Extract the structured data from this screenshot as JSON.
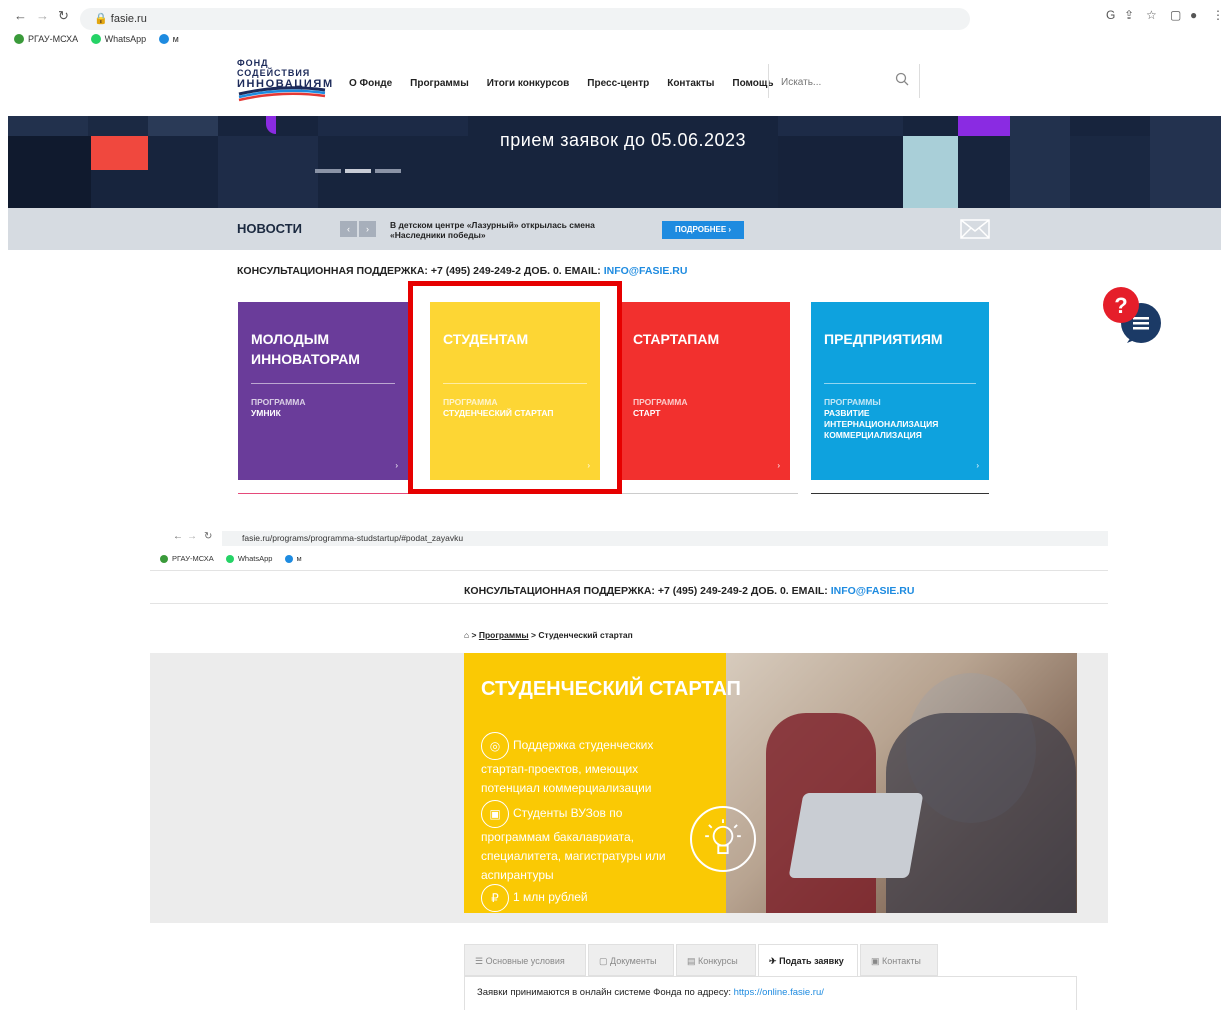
{
  "browser1": {
    "url": "fasie.ru",
    "bookmarks": [
      {
        "label": "РГАУ-МСХА",
        "color": "#3a9a3a"
      },
      {
        "label": "WhatsApp",
        "color": "#25d366"
      },
      {
        "label": "м",
        "color": "#1e8be0"
      }
    ]
  },
  "header": {
    "logo_line1": "ФОНД СОДЕЙСТВИЯ",
    "logo_line2": "ИННОВАЦИЯМ",
    "menu": [
      "О Фонде",
      "Программы",
      "Итоги конкурсов",
      "Пресс-центр",
      "Контакты",
      "Помощь"
    ],
    "search_placeholder": "Искать..."
  },
  "hero": {
    "text": "прием заявок до 05.06.2023"
  },
  "news": {
    "title": "НОВОСТИ",
    "prev": "‹",
    "next": "›",
    "text": "В детском центре «Лазурный» открылась смена «Наследники победы»",
    "more": "ПОДРОБНЕЕ ›"
  },
  "support": {
    "label": "КОНСУЛЬТАЦИОННАЯ ПОДДЕРЖКА: +7 (495) 249-249-2 ДОБ. 0. EMAIL: ",
    "email": "INFO@FASIE.RU"
  },
  "cards": [
    {
      "title": "МОЛОДЫМ ИННОВАТОРАМ",
      "prog_label": "ПРОГРАММА",
      "programs": "УМНИК",
      "color": "#6a3c9a"
    },
    {
      "title": "СТУДЕНТАМ",
      "prog_label": "ПРОГРАММА",
      "programs": "СТУДЕНЧЕСКИЙ СТАРТАП",
      "color": "#fdd634"
    },
    {
      "title": "СТАРТАПАМ",
      "prog_label": "ПРОГРАММА",
      "programs": "СТАРТ",
      "color": "#f2302e"
    },
    {
      "title": "ПРЕДПРИЯТИЯМ",
      "prog_label": "ПРОГРАММЫ",
      "programs": "РАЗВИТИЕ\nИНТЕРНАЦИОНАЛИЗАЦИЯ\nКОММЕРЦИАЛИЗАЦИЯ",
      "color": "#0ea2de"
    }
  ],
  "card_arrow": "›",
  "browser2": {
    "url": "fasie.ru/programs/programma-studstartup/#podat_zayavku",
    "bookmarks": [
      "РГАУ-МСХА",
      "WhatsApp",
      "м"
    ]
  },
  "breadcrumb": {
    "sep": ">",
    "programs": "Программы",
    "current": "Студенческий стартап"
  },
  "banner": {
    "title": "СТУДЕНЧЕСКИЙ СТАРТАП",
    "feature1": "Поддержка студенческих стартап-проектов, имеющих потенциал коммерциализации",
    "feature2": "Студенты ВУЗов по программам бакалавриата, специалитета, магистратуры или аспирантуры",
    "feature3": "1 млн рублей",
    "ruble_symbol": "₽"
  },
  "tabs": [
    {
      "label": "Основные условия",
      "icon": "☰"
    },
    {
      "label": "Документы",
      "icon": "▢"
    },
    {
      "label": "Конкурсы",
      "icon": "▤"
    },
    {
      "label": "Подать заявку",
      "icon": "✈"
    },
    {
      "label": "Контакты",
      "icon": "▣"
    }
  ],
  "tab_content": {
    "text": "Заявки принимаются в онлайн системе Фонда по адресу: ",
    "link": "https://online.fasie.ru/"
  }
}
